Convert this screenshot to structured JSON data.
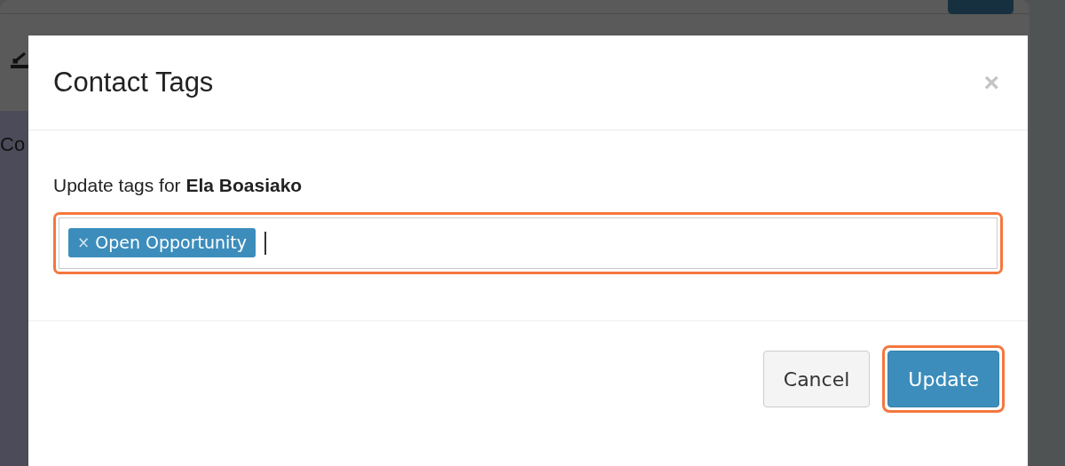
{
  "background": {
    "page_text": "Co"
  },
  "dialog": {
    "title": "Contact Tags",
    "close": "×",
    "prompt": "Update tags for **Ela Boasiako**",
    "tag_field": {
      "highlighted": true,
      "tags": [
        {
          "label": "Open Opportunity",
          "remove": "×"
        }
      ]
    },
    "buttons": [
      {
        "label": "Cancel",
        "kind": "secondary",
        "highlighted": false
      },
      {
        "label": "Update",
        "kind": "primary",
        "highlighted": true
      }
    ]
  }
}
